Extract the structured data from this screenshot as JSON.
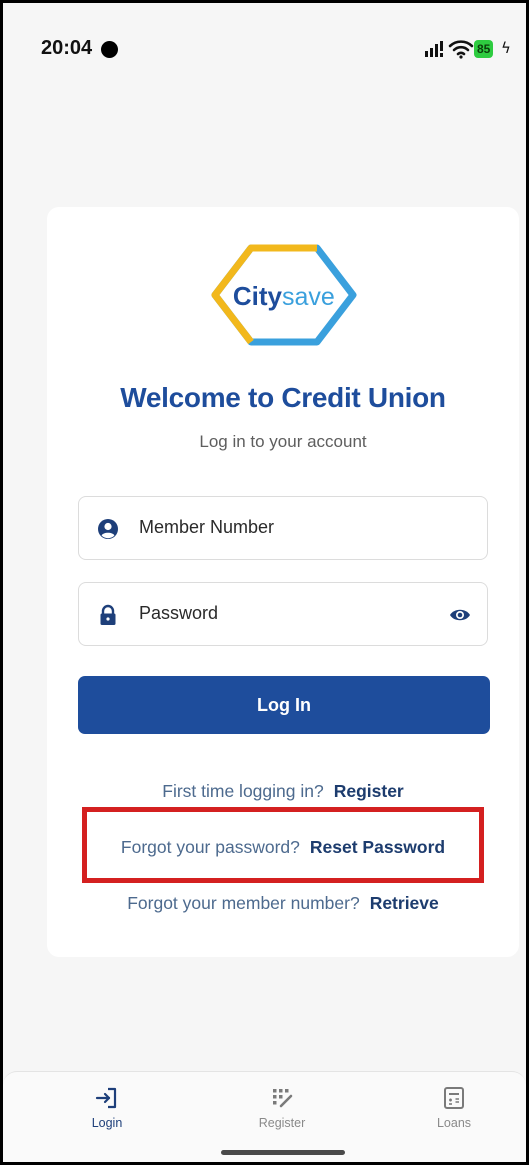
{
  "status_bar": {
    "time": "20:04",
    "battery": "85",
    "icons": [
      "signal-icon",
      "wifi-icon",
      "charging-icon"
    ]
  },
  "brand": {
    "logo_bold": "City",
    "logo_light": "save",
    "colors": {
      "primary": "#1e4d9c",
      "logo_yellow": "#f2b81c",
      "logo_blue": "#3aa0dd"
    }
  },
  "login": {
    "title": "Welcome to Credit Union",
    "subtitle": "Log in to your account",
    "member_number_placeholder": "Member Number",
    "password_placeholder": "Password",
    "login_button": "Log In"
  },
  "links": {
    "register_prompt": "First time logging in?",
    "register_action": "Register",
    "reset_prompt": "Forgot your password?",
    "reset_action": "Reset Password",
    "retrieve_prompt": "Forgot your member number?",
    "retrieve_action": "Retrieve"
  },
  "bottom_nav": {
    "items": [
      {
        "label": "Login",
        "icon": "login-icon",
        "active": true
      },
      {
        "label": "Register",
        "icon": "register-icon",
        "active": false
      },
      {
        "label": "Loans",
        "icon": "calculator-icon",
        "active": false
      }
    ]
  },
  "highlight_color": "#d42020"
}
